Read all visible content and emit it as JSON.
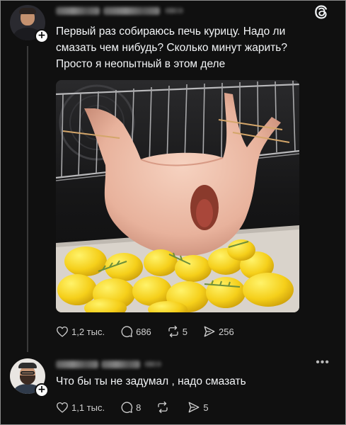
{
  "post": {
    "text": "Первый раз собираюсь печь курицу. Надо ли\nсмазать чем нибудь? Сколько минут жарить?\nПросто я неопытный в этом деле",
    "avatar_icon": "user-avatar-icon",
    "follow_icon": "plus-icon",
    "app_icon": "threads-logo-icon",
    "likes": "1,2 тыс.",
    "comments": "686",
    "reposts": "5",
    "shares": "256"
  },
  "comment": {
    "text": "Что бы ты не задумал , надо смазать",
    "more_icon": "more-dots-icon",
    "likes": "1,1 тыс.",
    "comments": "8",
    "reposts": "",
    "shares": "5"
  },
  "colors": {
    "background": "#101010",
    "text": "#f3f5f7",
    "secondary": "#cfcfcf",
    "thread_line": "#3a3a3a"
  }
}
